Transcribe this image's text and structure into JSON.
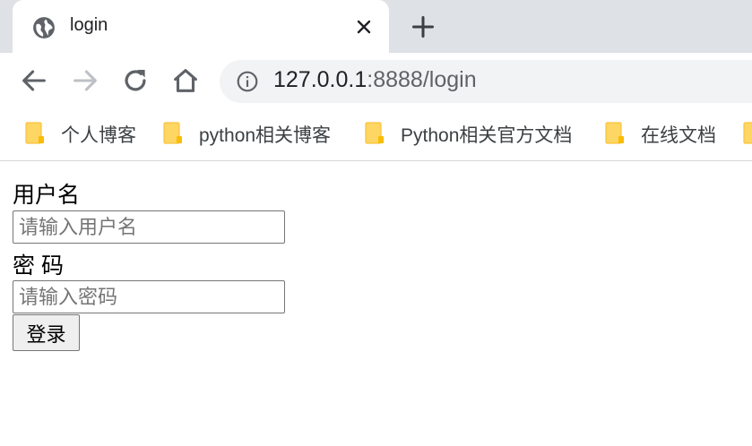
{
  "browser": {
    "tab": {
      "title": "login",
      "favicon": "globe-icon"
    },
    "new_tab_icon": "plus-icon",
    "close_icon": "close-icon",
    "nav": {
      "back_icon": "arrow-left-icon",
      "forward_icon": "arrow-right-icon",
      "reload_icon": "reload-icon",
      "home_icon": "home-icon"
    },
    "address": {
      "host": "127.0.0.1",
      "rest": ":8888/login",
      "info_icon": "info-icon"
    },
    "bookmarks": [
      {
        "label": "个人博客",
        "icon": "folder-icon"
      },
      {
        "label": "python相关博客",
        "icon": "folder-icon"
      },
      {
        "label": "Python相关官方文档",
        "icon": "folder-icon"
      },
      {
        "label": "在线文档",
        "icon": "folder-icon"
      },
      {
        "label": "",
        "icon": "folder-icon"
      }
    ]
  },
  "form": {
    "username_label": "用户名",
    "username_placeholder": "请输入用户名",
    "password_label": "密 码",
    "password_placeholder": "请输入密码",
    "submit_label": "登录"
  },
  "colors": {
    "tabstrip": "#dee1e6",
    "omnibox": "#f1f3f4",
    "folder": "#fdd663",
    "folder_border": "#f9c33c"
  }
}
